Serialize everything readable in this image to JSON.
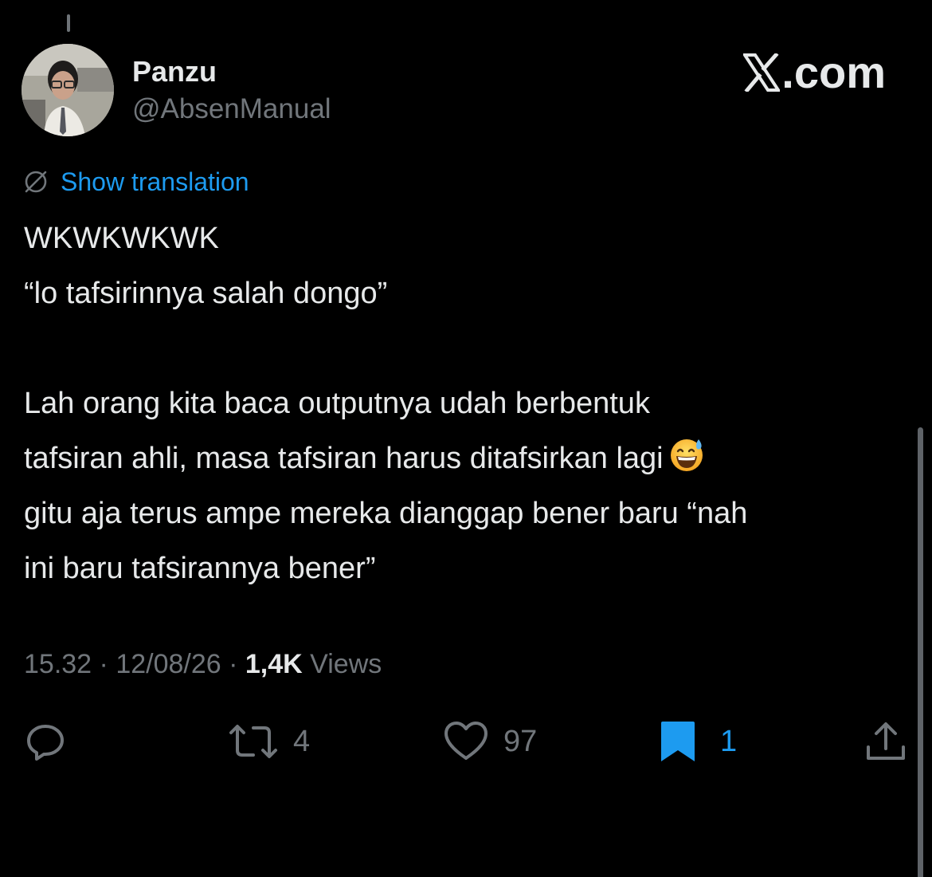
{
  "header": {
    "display_name": "Panzu",
    "handle": "@AbsenManual",
    "brand": ".com"
  },
  "translation": {
    "label": "Show translation",
    "icon": "globe-icon"
  },
  "post": {
    "lines": [
      "WKWKWKWK",
      "“lo tafsirinnya salah dongo”",
      "",
      "Lah orang kita baca outputnya udah berbentuk",
      "tafsiran ahli, masa tafsiran harus ditafsirkan lagi",
      "gitu aja terus ampe mereka dianggap bener baru “nah",
      "ini baru tafsirannya bener”"
    ],
    "emoji": "grinning-face-with-sweat-emoji"
  },
  "meta": {
    "time": "15.32",
    "separator": " · ",
    "date": "12/08/26",
    "views_count": "1,4K",
    "views_label": " Views"
  },
  "actions": {
    "reply": {
      "icon": "reply-icon"
    },
    "repost": {
      "icon": "repost-icon",
      "count": "4"
    },
    "like": {
      "icon": "heart-icon",
      "count": "97"
    },
    "bookmark": {
      "icon": "bookmark-icon",
      "count": "1",
      "active": true
    },
    "share": {
      "icon": "share-icon"
    }
  },
  "colors": {
    "background": "#000000",
    "text": "#e7e9ea",
    "secondary": "#71767b",
    "accent": "#1d9bf0"
  }
}
